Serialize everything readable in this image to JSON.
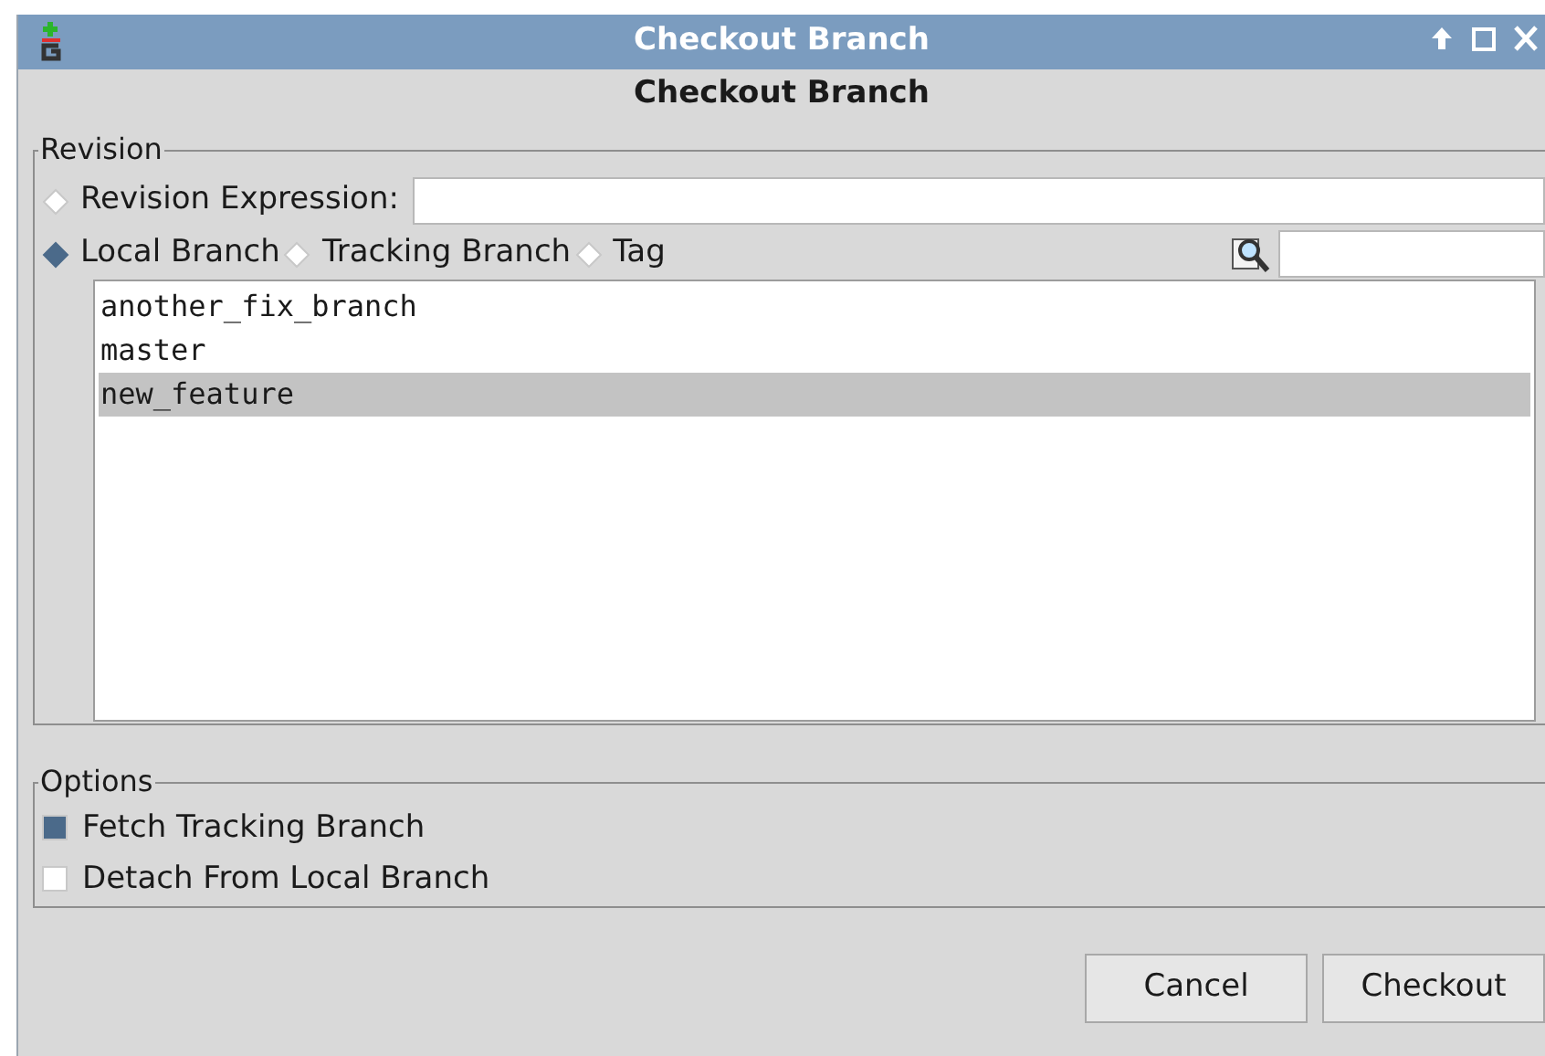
{
  "window": {
    "title": "Checkout Branch"
  },
  "heading": "Checkout Branch",
  "revision": {
    "legend": "Revision",
    "expression": {
      "label": "Revision Expression:",
      "selected": false
    },
    "sources": [
      {
        "label": "Local Branch",
        "selected": true
      },
      {
        "label": "Tracking Branch",
        "selected": false
      },
      {
        "label": "Tag",
        "selected": false
      }
    ],
    "branches": [
      {
        "name": "another_fix_branch",
        "selected": false
      },
      {
        "name": "master",
        "selected": false
      },
      {
        "name": "new_feature",
        "selected": true
      }
    ]
  },
  "options": {
    "legend": "Options",
    "items": [
      {
        "label": "Fetch Tracking Branch",
        "checked": true
      },
      {
        "label": "Detach From Local Branch",
        "checked": false
      }
    ]
  },
  "buttons": [
    "Cancel",
    "Checkout"
  ]
}
